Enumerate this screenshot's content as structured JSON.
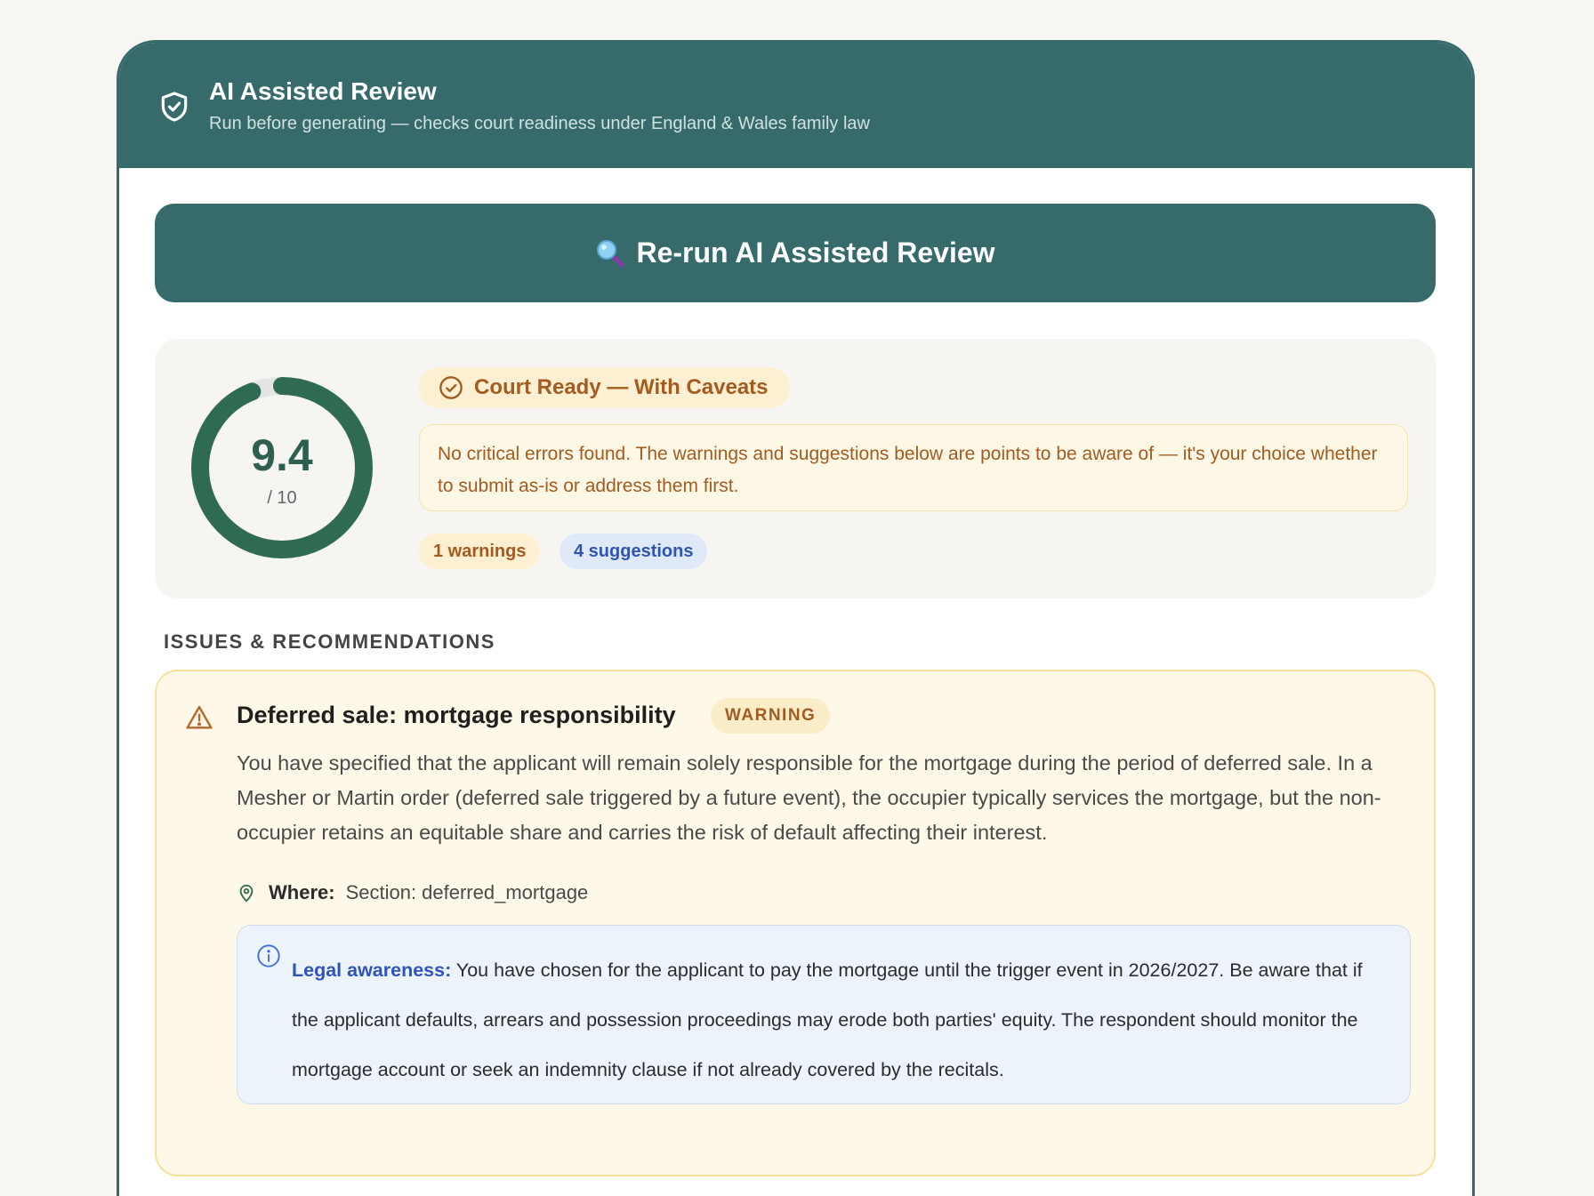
{
  "header": {
    "icon": "shield-check-icon",
    "title": "AI Assisted Review",
    "subtitle": "Run before generating — checks court readiness under England & Wales family law"
  },
  "rerun_button": {
    "icon": "magnifier-icon",
    "label": "Re-run AI Assisted Review"
  },
  "score": {
    "value": "9.4",
    "max_label": "/ 10",
    "fraction": 0.94,
    "color": "#2f6a52"
  },
  "status": {
    "icon": "check-circle-icon",
    "label": "Court Ready — With Caveats",
    "note": "No critical errors found. The warnings and suggestions below are points to be aware of — it's your choice whether to submit as-is or address them first."
  },
  "counts": {
    "warnings": "1 warnings",
    "suggestions": "4 suggestions"
  },
  "section_title": "ISSUES & RECOMMENDATIONS",
  "issues": [
    {
      "icon": "warning-triangle-icon",
      "title": "Deferred sale: mortgage responsibility",
      "badge": "WARNING",
      "description": "You have specified that the applicant will remain solely responsible for the mortgage during the period of deferred sale. In a Mesher or Martin order (deferred sale triggered by a future event), the occupier typically services the mortgage, but the non-occupier retains an equitable share and carries the risk of default affecting their interest.",
      "where_label": "Where:",
      "where_value": "Section: deferred_mortgage",
      "legal_lead": "Legal awareness:",
      "legal_text": "You have chosen for the applicant to pay the mortgage until the trigger event in 2026/2027. Be aware that if the applicant defaults, arrears and possession proceedings may erode both parties' equity. The respondent should monitor the mortgage account or seek an indemnity clause if not already covered by the recitals."
    }
  ],
  "colors": {
    "brand": "#376b6b",
    "warning": "#a35b1f",
    "suggestion": "#2f54b8"
  }
}
